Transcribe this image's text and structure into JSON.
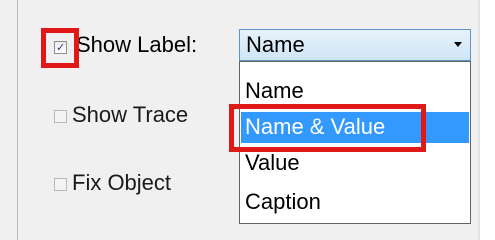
{
  "form": {
    "show_label": {
      "label": "Show Label:",
      "checked": true,
      "check_glyph": "✓"
    },
    "show_trace": {
      "label": "Show Trace",
      "checked": false
    },
    "fix_object": {
      "label": "Fix Object",
      "checked": false
    },
    "label_select": {
      "value": "Name",
      "options": [
        "Name",
        "Name & Value",
        "Value",
        "Caption"
      ],
      "highlighted": "Name & Value"
    }
  },
  "colors": {
    "annotation_red": "#e01818",
    "selection_blue": "#3399ff",
    "panel_bg": "#f0f0f0"
  }
}
